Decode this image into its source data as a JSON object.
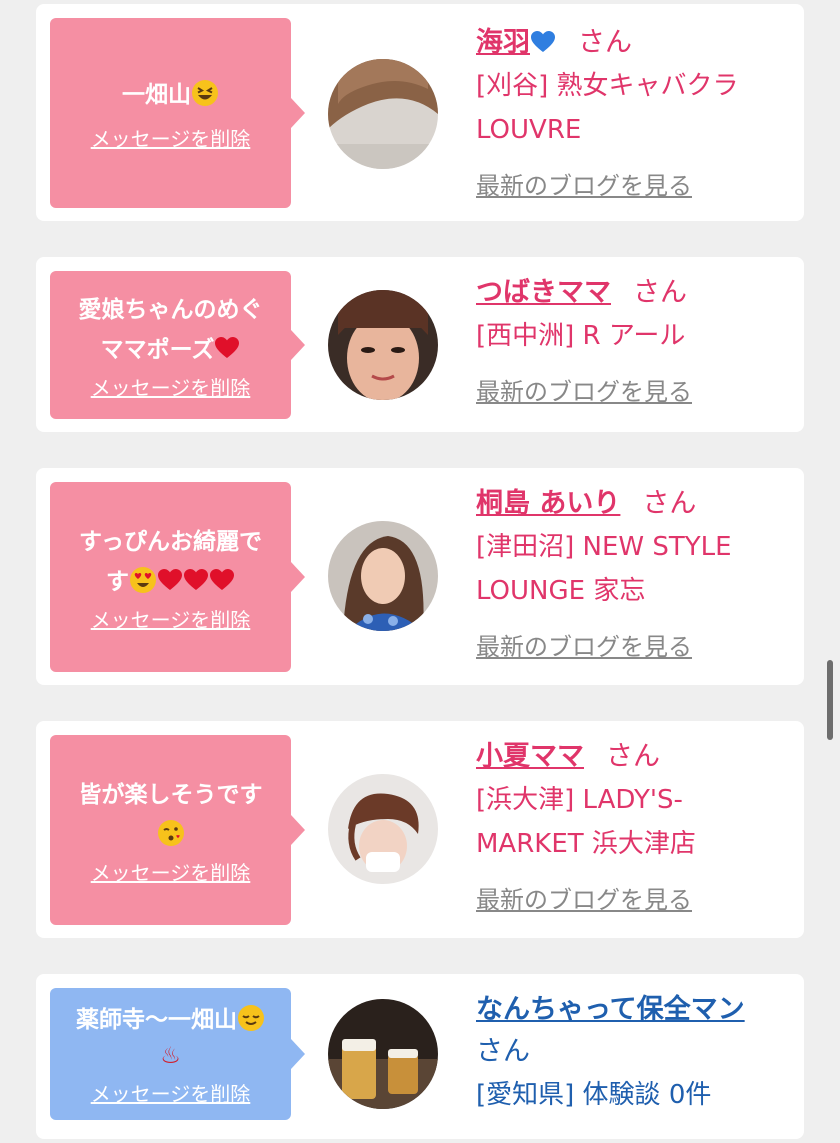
{
  "cards": [
    {
      "message": "一畑山",
      "delete_label": "メッセージを削除",
      "name": "海羽",
      "name_suffix": "さん",
      "shop_line1": "[刈谷] 熟女キャバクラ",
      "shop_line2": "LOUVRE",
      "blog_label": "最新のブログを見る"
    },
    {
      "message_line1": "愛娘ちゃんのめぐ",
      "message_line2": "ママポーズ",
      "delete_label": "メッセージを削除",
      "name": "つばきママ",
      "name_suffix": "さん",
      "shop_line1": "[西中洲] R アール",
      "blog_label": "最新のブログを見る"
    },
    {
      "message_line1": "すっぴんお綺麗で",
      "message_line2": "す",
      "delete_label": "メッセージを削除",
      "name": "桐島 あいり",
      "name_suffix": "さん",
      "shop_line1": "[津田沼] NEW STYLE",
      "shop_line2": "LOUNGE 家忘",
      "blog_label": "最新のブログを見る"
    },
    {
      "message_line1": "皆が楽しそうです",
      "delete_label": "メッセージを削除",
      "name": "小夏ママ",
      "name_suffix": "さん",
      "shop_line1": "[浜大津] LADY'S-",
      "shop_line2": "MARKET 浜大津店",
      "blog_label": "最新のブログを見る"
    },
    {
      "message_line1": "薬師寺〜一畑山",
      "message_line2": "♨",
      "delete_label": "メッセージを削除",
      "name": "なんちゃって保全マン",
      "name_suffix": "さん",
      "shop_line1": "[愛知県] 体験談 0件"
    }
  ],
  "colors": {
    "pink_bubble": "#f58fa3",
    "blue_bubble": "#8fb7f2",
    "pink_text": "#e0356a",
    "blue_text": "#1f5fae"
  }
}
